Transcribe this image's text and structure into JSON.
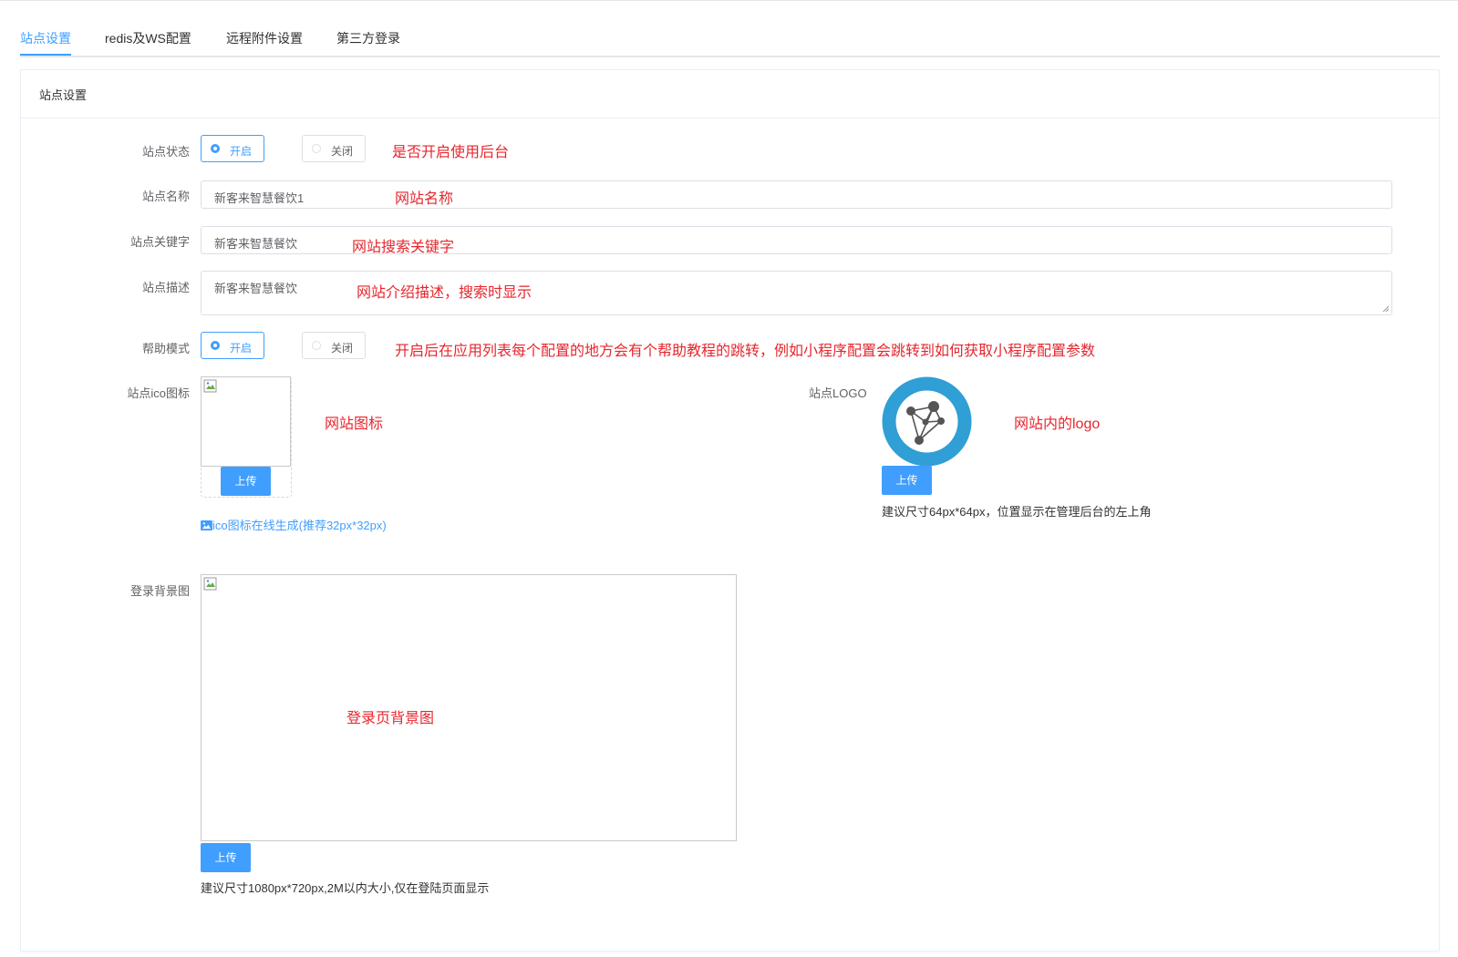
{
  "tabs": [
    "站点设置",
    "redis及WS配置",
    "远程附件设置",
    "第三方登录"
  ],
  "card_title": "站点设置",
  "form": {
    "site_status": {
      "label": "站点状态",
      "on": "开启",
      "off": "关闭",
      "selected": "开启",
      "note": "是否开启使用后台"
    },
    "site_name": {
      "label": "站点名称",
      "value": "新客来智慧餐饮1",
      "note": "网站名称"
    },
    "site_keywords": {
      "label": "站点关键字",
      "value": "新客来智慧餐饮",
      "note": "网站搜索关键字"
    },
    "site_desc": {
      "label": "站点描述",
      "value": "新客来智慧餐饮",
      "note": "网站介绍描述，搜索时显示"
    },
    "help_mode": {
      "label": "帮助模式",
      "on": "开启",
      "off": "关闭",
      "selected": "开启",
      "note": "开启后在应用列表每个配置的地方会有个帮助教程的跳转，例如小程序配置会跳转到如何获取小程序配置参数"
    },
    "site_ico": {
      "label": "站点ico图标",
      "upload": "上传",
      "note": "网站图标",
      "link": "ico图标在线生成(推荐32px*32px)"
    },
    "site_logo": {
      "label": "站点LOGO",
      "upload": "上传",
      "note": "网站内的logo",
      "hint": "建议尺寸64px*64px，位置显示在管理后台的左上角"
    },
    "login_bg": {
      "label": "登录背景图",
      "upload": "上传",
      "note": "登录页背景图",
      "hint": "建议尺寸1080px*720px,2M以内大小,仅在登陆页面显示"
    }
  },
  "colors": {
    "primary": "#409eff",
    "annotation": "#e6262d",
    "logo_ring": "#2f9fd6"
  },
  "icons": {
    "broken_image": "broken-image-icon",
    "image_link": "image-icon",
    "logo": "network-graph-icon"
  }
}
